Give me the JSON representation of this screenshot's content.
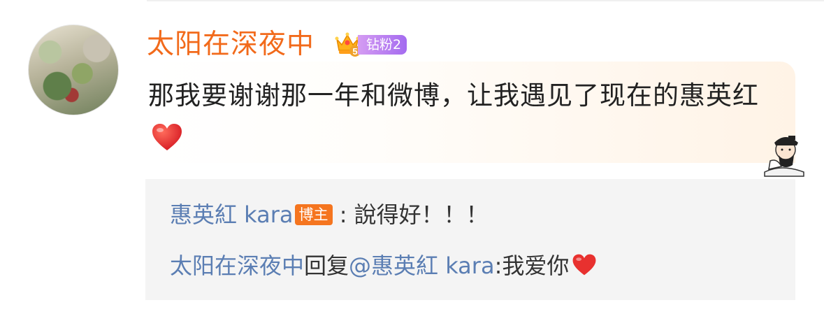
{
  "comment": {
    "username": "太阳在深夜中",
    "fan_badge": "钻粉2",
    "crown_level": "5",
    "text": "那我要谢谢那一年和微博，让我遇见了现在的惠英红",
    "emoji": "heart-emoji"
  },
  "replies": [
    {
      "author": "惠英紅 kara",
      "author_badge": "博主",
      "separator": " : ",
      "text": "說得好！！！"
    },
    {
      "author": "太阳在深夜中",
      "action": "回复",
      "mention": "@惠英紅 kara",
      "separator": ":",
      "text": "我爱你",
      "emoji": "heart-emoji"
    }
  ],
  "colors": {
    "username": "#f26a1b",
    "link": "#5b7eb3",
    "fan_badge": "#b47cf0",
    "blogger_badge": "#f5751f",
    "heart": "#e8312f"
  }
}
